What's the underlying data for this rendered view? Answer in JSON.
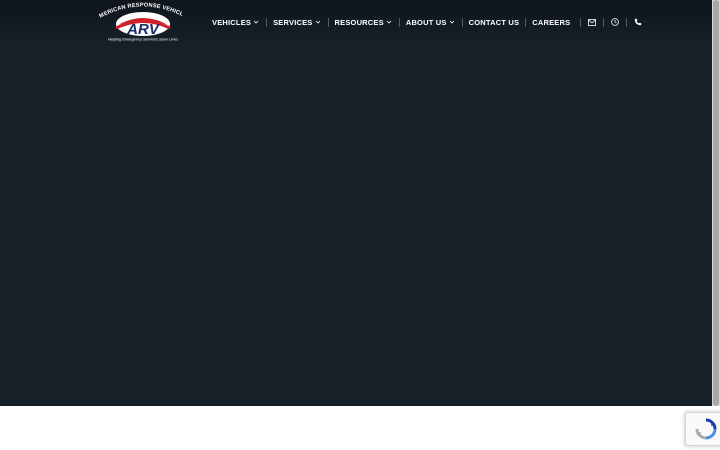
{
  "brand": {
    "name": "AMERICAN RESPONSE VEHICLES",
    "initials": "ARV",
    "tagline": "Helping Emergency Services Save Lives"
  },
  "nav": {
    "items": [
      {
        "label": "VEHICLES",
        "dropdown": true
      },
      {
        "label": "SERVICES",
        "dropdown": true
      },
      {
        "label": "RESOURCES",
        "dropdown": true
      },
      {
        "label": "ABOUT US",
        "dropdown": true
      },
      {
        "label": "CONTACT US",
        "dropdown": false
      },
      {
        "label": "CAREERS",
        "dropdown": false
      }
    ],
    "icons": [
      "envelope-icon",
      "clock-icon",
      "phone-icon"
    ]
  },
  "colors": {
    "hero_background": "#162029",
    "brand_red": "#d0202a",
    "brand_navy": "#1b2f6e",
    "nav_text": "#ffffff"
  }
}
